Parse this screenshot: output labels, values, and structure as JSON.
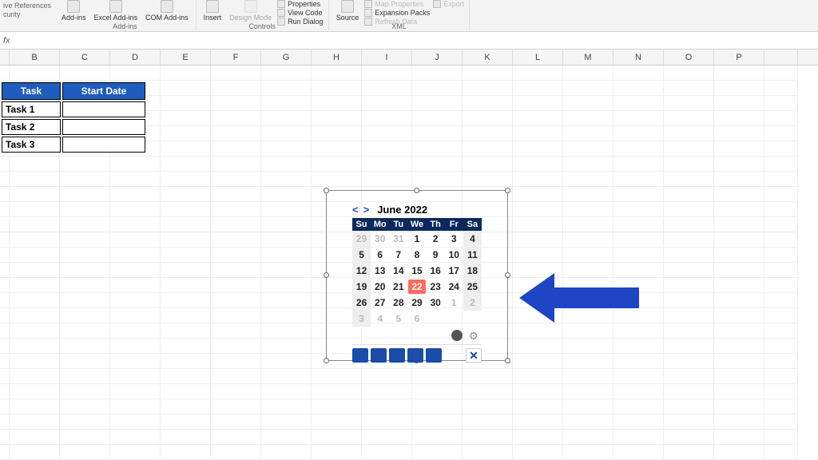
{
  "ribbon": {
    "partial_left": [
      "ive References",
      "curity"
    ],
    "addins": {
      "btns": [
        "Add-ins",
        "Excel Add-ins",
        "COM Add-ins"
      ],
      "label": "Add-ins"
    },
    "controls": {
      "insert": "Insert",
      "design": "Design Mode",
      "props": "Properties",
      "view_code": "View Code",
      "run_dialog": "Run Dialog",
      "label": "Controls"
    },
    "xml": {
      "source": "Source",
      "map": "Map Properties",
      "expansion": "Expansion Packs",
      "refresh": "Refresh Data",
      "export": "Export",
      "label": "XML"
    }
  },
  "formula_bar": {
    "fx": "fx"
  },
  "columns": [
    "B",
    "C",
    "D",
    "E",
    "F",
    "G",
    "H",
    "I",
    "J",
    "K",
    "L",
    "M",
    "N",
    "O",
    "P"
  ],
  "task_table": {
    "headers": [
      "Task",
      "Start Date"
    ],
    "rows": [
      "Task 1",
      "Task 2",
      "Task 3"
    ]
  },
  "calendar": {
    "prev": "<",
    "next": ">",
    "title": "June 2022",
    "day_labels": [
      "Su",
      "Mo",
      "Tu",
      "We",
      "Th",
      "Fr",
      "Sa"
    ],
    "weeks": [
      [
        {
          "d": "29",
          "o": 1,
          "w": 1
        },
        {
          "d": "30",
          "o": 1
        },
        {
          "d": "31",
          "o": 1
        },
        {
          "d": "1"
        },
        {
          "d": "2"
        },
        {
          "d": "3"
        },
        {
          "d": "4",
          "w": 1
        }
      ],
      [
        {
          "d": "5",
          "w": 1
        },
        {
          "d": "6"
        },
        {
          "d": "7"
        },
        {
          "d": "8"
        },
        {
          "d": "9"
        },
        {
          "d": "10"
        },
        {
          "d": "11",
          "w": 1
        }
      ],
      [
        {
          "d": "12",
          "w": 1
        },
        {
          "d": "13"
        },
        {
          "d": "14"
        },
        {
          "d": "15"
        },
        {
          "d": "16"
        },
        {
          "d": "17"
        },
        {
          "d": "18",
          "w": 1
        }
      ],
      [
        {
          "d": "19",
          "w": 1
        },
        {
          "d": "20"
        },
        {
          "d": "21"
        },
        {
          "d": "22",
          "t": 1
        },
        {
          "d": "23"
        },
        {
          "d": "24"
        },
        {
          "d": "25",
          "w": 1
        }
      ],
      [
        {
          "d": "26",
          "w": 1
        },
        {
          "d": "27"
        },
        {
          "d": "28"
        },
        {
          "d": "29"
        },
        {
          "d": "30"
        },
        {
          "d": "1",
          "o": 1
        },
        {
          "d": "2",
          "o": 1,
          "w": 1
        }
      ],
      [
        {
          "d": "3",
          "o": 1,
          "w": 1
        },
        {
          "d": "4",
          "o": 1
        },
        {
          "d": "5",
          "o": 1
        },
        {
          "d": "6",
          "o": 1
        },
        {
          "d": "",
          "b": 1
        },
        {
          "d": "",
          "b": 1
        },
        {
          "d": "",
          "b": 1
        }
      ]
    ],
    "tool_close": "✕"
  }
}
